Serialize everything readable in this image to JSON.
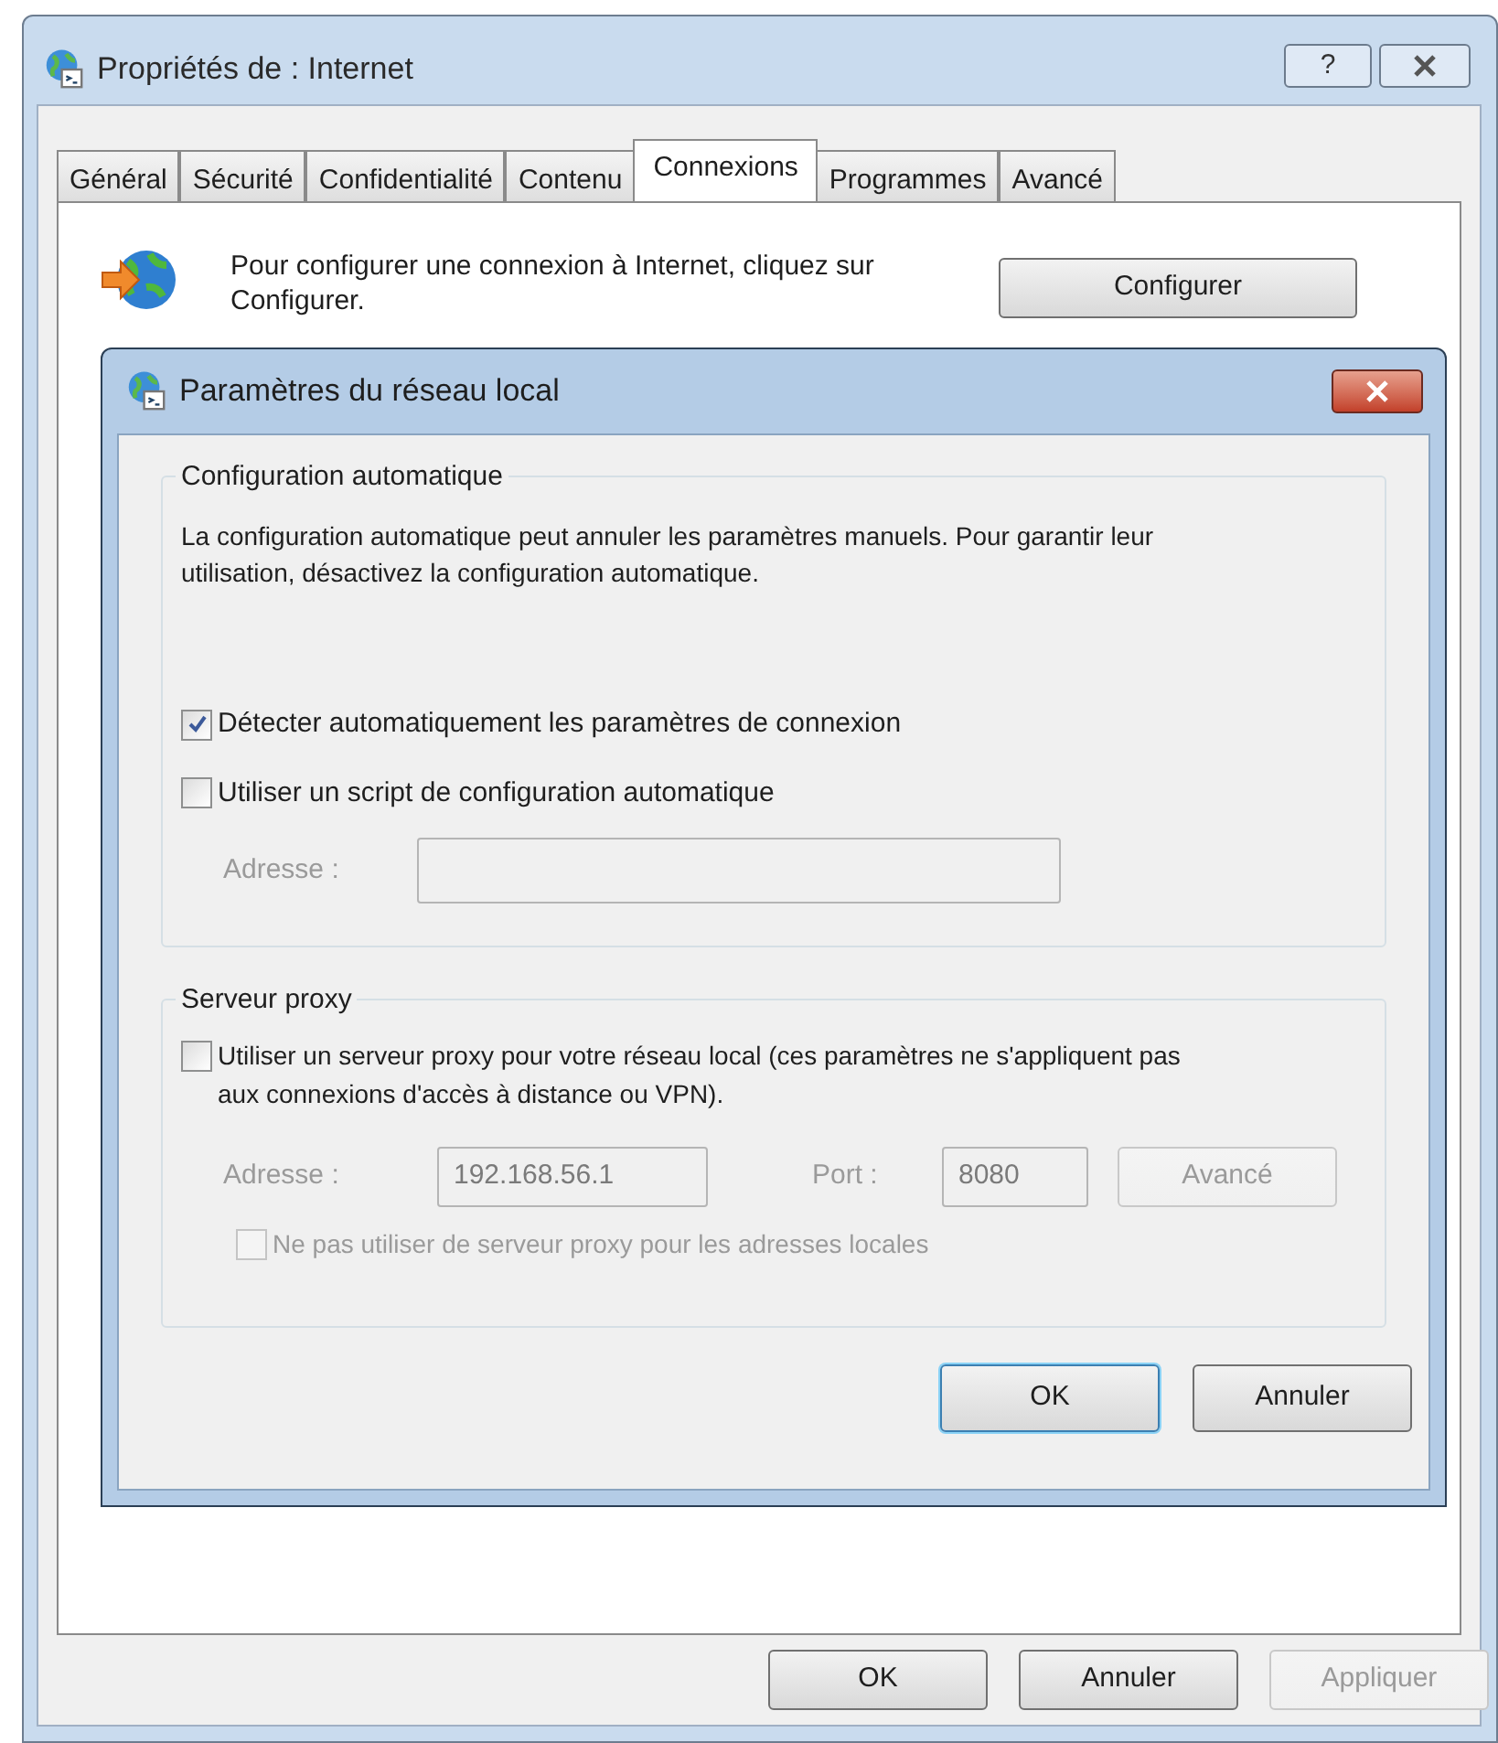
{
  "window": {
    "title": "Propriétés de : Internet",
    "help_button": "?"
  },
  "tabs": [
    {
      "label": "Général",
      "selected": false
    },
    {
      "label": "Sécurité",
      "selected": false
    },
    {
      "label": "Confidentialité",
      "selected": false
    },
    {
      "label": "Contenu",
      "selected": false
    },
    {
      "label": "Connexions",
      "selected": true
    },
    {
      "label": "Programmes",
      "selected": false
    },
    {
      "label": "Avancé",
      "selected": false
    }
  ],
  "connection_setup": {
    "text": "Pour configurer une connexion à Internet, cliquez sur Configurer.",
    "button": "Configurer"
  },
  "lan_dialog": {
    "title": "Paramètres du réseau local",
    "auto_config": {
      "title": "Configuration automatique",
      "description": "La configuration automatique peut annuler les paramètres manuels. Pour garantir leur utilisation, désactivez la configuration automatique.",
      "options": [
        {
          "label": "Détecter automatiquement les paramètres de connexion",
          "checked": true
        },
        {
          "label": "Utiliser un script de configuration automatique",
          "checked": false
        }
      ],
      "address": {
        "label": "Adresse :",
        "disabled": true
      }
    },
    "proxy": {
      "title": "Serveur proxy",
      "option": {
        "label": "Utiliser un serveur proxy pour votre réseau local (ces paramètres ne s'appliquent pas aux connexions d'accès à distance ou VPN).",
        "checked": false
      },
      "address": {
        "label": "Adresse :",
        "value": "192.168.56.1",
        "disabled": true
      },
      "port": {
        "label": "Port :",
        "value": "8080",
        "disabled": true
      },
      "advanced_button": {
        "label": "Avancé",
        "disabled": true
      },
      "bypass": {
        "label": "Ne pas utiliser de serveur proxy pour les adresses locales",
        "checked": false,
        "disabled": true
      }
    },
    "buttons": [
      {
        "label": "OK",
        "default": true
      },
      {
        "label": "Annuler",
        "default": false
      }
    ]
  },
  "buttons": [
    {
      "label": "OK",
      "disabled": false
    },
    {
      "label": "Annuler",
      "disabled": false
    },
    {
      "label": "Appliquer",
      "disabled": true
    }
  ]
}
